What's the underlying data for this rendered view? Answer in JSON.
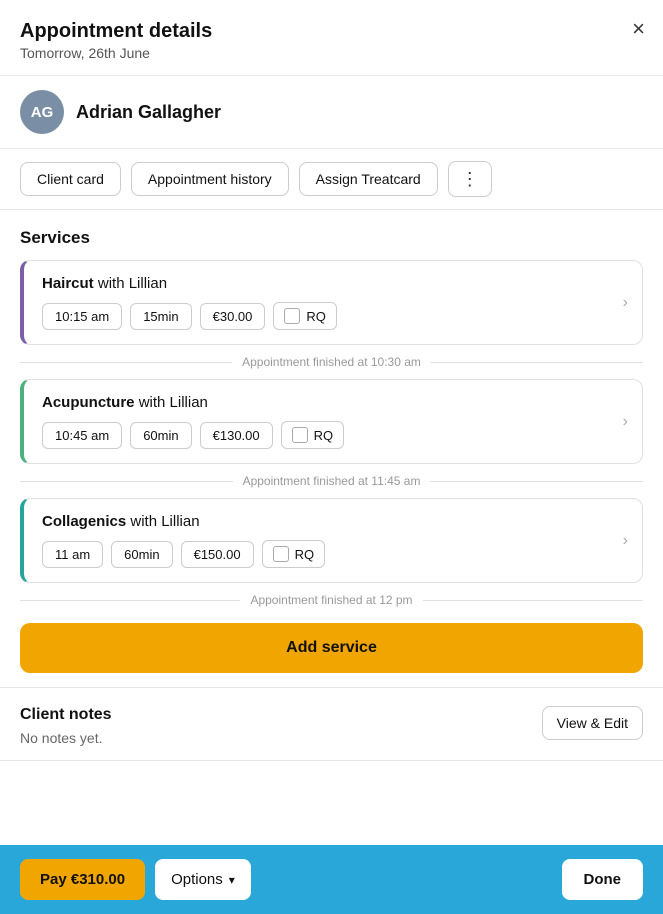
{
  "header": {
    "title": "Appointment details",
    "subtitle": "Tomorrow, 26th June",
    "close_label": "×"
  },
  "client": {
    "initials": "AG",
    "name": "Adrian Gallagher"
  },
  "action_buttons": {
    "client_card": "Client card",
    "appointment_history": "Appointment history",
    "assign_treatcard": "Assign Treatcard",
    "more_icon": "⋮"
  },
  "services_section": {
    "title": "Services",
    "services": [
      {
        "id": "haircut",
        "name": "Haircut",
        "with": "with Lillian",
        "time": "10:15 am",
        "duration": "15min",
        "price": "€30.00",
        "rq_label": "RQ",
        "border_color": "purple-left",
        "finished_at": "Appointment finished at 10:30 am"
      },
      {
        "id": "acupuncture",
        "name": "Acupuncture",
        "with": "with Lillian",
        "time": "10:45 am",
        "duration": "60min",
        "price": "€130.00",
        "rq_label": "RQ",
        "border_color": "green-left",
        "finished_at": "Appointment finished at 11:45 am"
      },
      {
        "id": "collagenics",
        "name": "Collagenics",
        "with": "with Lillian",
        "time": "11 am",
        "duration": "60min",
        "price": "€150.00",
        "rq_label": "RQ",
        "border_color": "teal-left",
        "finished_at": "Appointment finished at 12 pm"
      }
    ],
    "add_service_label": "Add service"
  },
  "client_notes": {
    "title": "Client notes",
    "text": "No notes yet.",
    "view_edit_label": "View & Edit"
  },
  "bottom_bar": {
    "pay_label": "Pay €310.00",
    "options_label": "Options",
    "done_label": "Done"
  }
}
